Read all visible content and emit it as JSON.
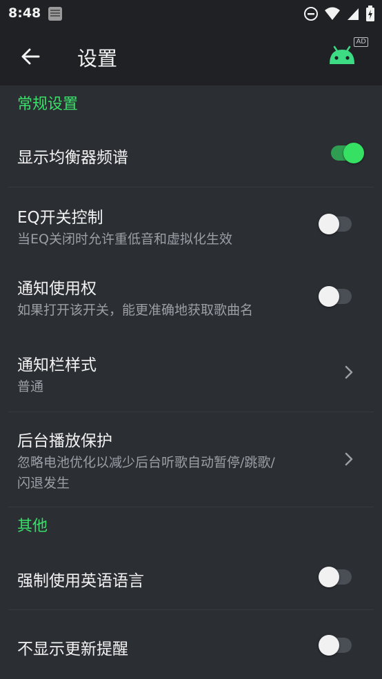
{
  "status_bar": {
    "time": "8:48"
  },
  "app_bar": {
    "title": "设置",
    "ad_label": "AD"
  },
  "sections": {
    "general": {
      "header": "常规设置"
    },
    "other": {
      "header": "其他"
    }
  },
  "items": {
    "equalizer_spectrum": {
      "title": "显示均衡器频谱",
      "enabled": true
    },
    "eq_switch": {
      "title": "EQ开关控制",
      "subtitle": "当EQ关闭时允许重低音和虚拟化生效",
      "enabled": false
    },
    "notification_access": {
      "title": "通知使用权",
      "subtitle": "如果打开该开关，能更准确地获取歌曲名",
      "enabled": false
    },
    "notification_style": {
      "title": "通知栏样式",
      "subtitle": "普通"
    },
    "background_protection": {
      "title": "后台播放保护",
      "subtitle_line1": "忽略电池优化以减少后台听歌自动暂停/跳歌/",
      "subtitle_line2": "闪退发生"
    },
    "force_english": {
      "title": "强制使用英语语言",
      "enabled": false
    },
    "hide_update": {
      "title": "不显示更新提醒",
      "enabled": false
    }
  },
  "colors": {
    "accent": "#3ae06a",
    "background": "#2b2e33",
    "bar": "#1f2125"
  }
}
